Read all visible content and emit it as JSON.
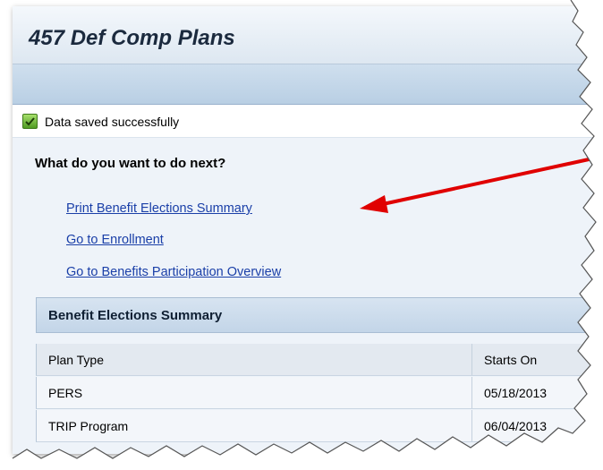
{
  "window": {
    "title": "457 Def Comp Plans"
  },
  "message": {
    "icon": "checkmark-icon",
    "text": "Data saved successfully"
  },
  "next_steps": {
    "heading": "What do you want to do next?",
    "links": [
      "Print Benefit Elections Summary",
      "Go to Enrollment",
      "Go to Benefits Participation Overview"
    ]
  },
  "summary_table": {
    "title": "Benefit Elections Summary",
    "columns": [
      "Plan Type",
      "Starts On"
    ],
    "rows": [
      [
        "PERS",
        "05/18/2013"
      ],
      [
        "TRIP Program",
        "06/04/2013"
      ]
    ]
  },
  "colors": {
    "link": "#1a3fa8",
    "arrow": "#e00000",
    "header_bg": "#b9cfe4"
  }
}
